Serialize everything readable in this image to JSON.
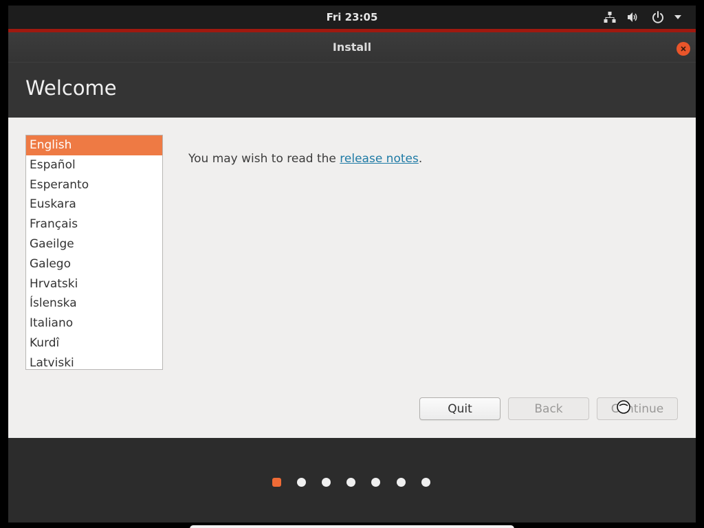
{
  "topbar": {
    "clock": "Fri 23:05",
    "icons": [
      "network-icon",
      "volume-icon",
      "power-icon",
      "chevron-down-icon"
    ]
  },
  "window": {
    "title": "Install"
  },
  "header": {
    "title": "Welcome"
  },
  "languages": {
    "selected": "English",
    "items": [
      "English",
      "Español",
      "Esperanto",
      "Euskara",
      "Français",
      "Gaeilge",
      "Galego",
      "Hrvatski",
      "Íslenska",
      "Italiano",
      "Kurdî",
      "Latviski"
    ]
  },
  "notes": {
    "prefix": "You may wish to read the ",
    "link": "release notes",
    "suffix": "."
  },
  "buttons": {
    "quit": "Quit",
    "back": "Back",
    "continue": "Continue"
  },
  "progress": {
    "total_steps": 7,
    "current_step": 1
  },
  "colors": {
    "accent": "#ee7a44",
    "selection": "#ee7a44",
    "link": "#1e7aa5",
    "titlebar_accent": "#a0190f"
  }
}
